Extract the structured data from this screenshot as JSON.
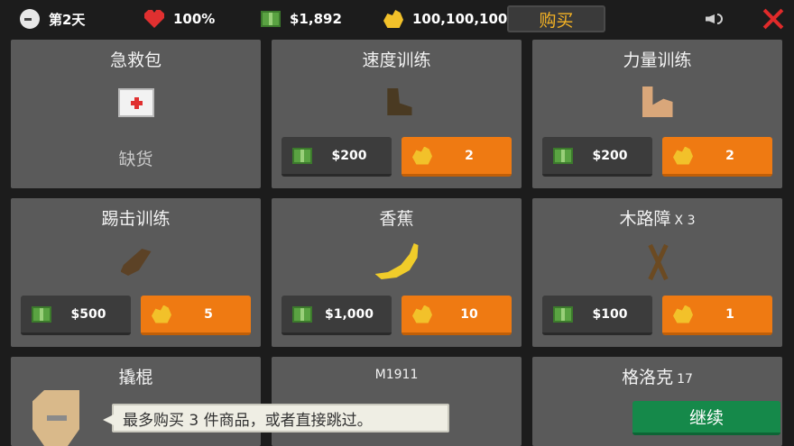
{
  "hud": {
    "day": "第2天",
    "health": "100%",
    "cash": "$1,892",
    "gold": "100,100,100",
    "buy_label": "购买",
    "icons": [
      "clock-icon",
      "heart-icon",
      "cash-icon",
      "gold-icon",
      "sound-icon",
      "close-icon"
    ]
  },
  "shop": {
    "items": [
      {
        "name": "急救包",
        "status": "缺货",
        "icon": "first-aid-kit"
      },
      {
        "name": "速度训练",
        "cash": "$200",
        "gold": "2",
        "icon": "boot"
      },
      {
        "name": "力量训练",
        "cash": "$200",
        "gold": "2",
        "icon": "flexed-arm"
      },
      {
        "name": "踢击训练",
        "cash": "$500",
        "gold": "5",
        "icon": "kicking-leg"
      },
      {
        "name": "香蕉",
        "cash": "$1,000",
        "gold": "10",
        "icon": "banana"
      },
      {
        "name": "木路障",
        "qty": "X 3",
        "cash": "$100",
        "gold": "1",
        "icon": "wooden-barricade"
      },
      {
        "name": "撬棍"
      },
      {
        "name": "M1911"
      },
      {
        "name": "格洛克",
        "qty": "17"
      }
    ]
  },
  "footer": {
    "hint": "最多购买 3 件商品，或者直接跳过。",
    "continue_label": "继续"
  },
  "colors": {
    "background": "#1c1c1c",
    "card": "#5a5a5a",
    "gold_button": "#ef7a12",
    "cash_button": "#3c3c3c",
    "continue_button": "#15894a",
    "buy_text": "#f5b324"
  }
}
